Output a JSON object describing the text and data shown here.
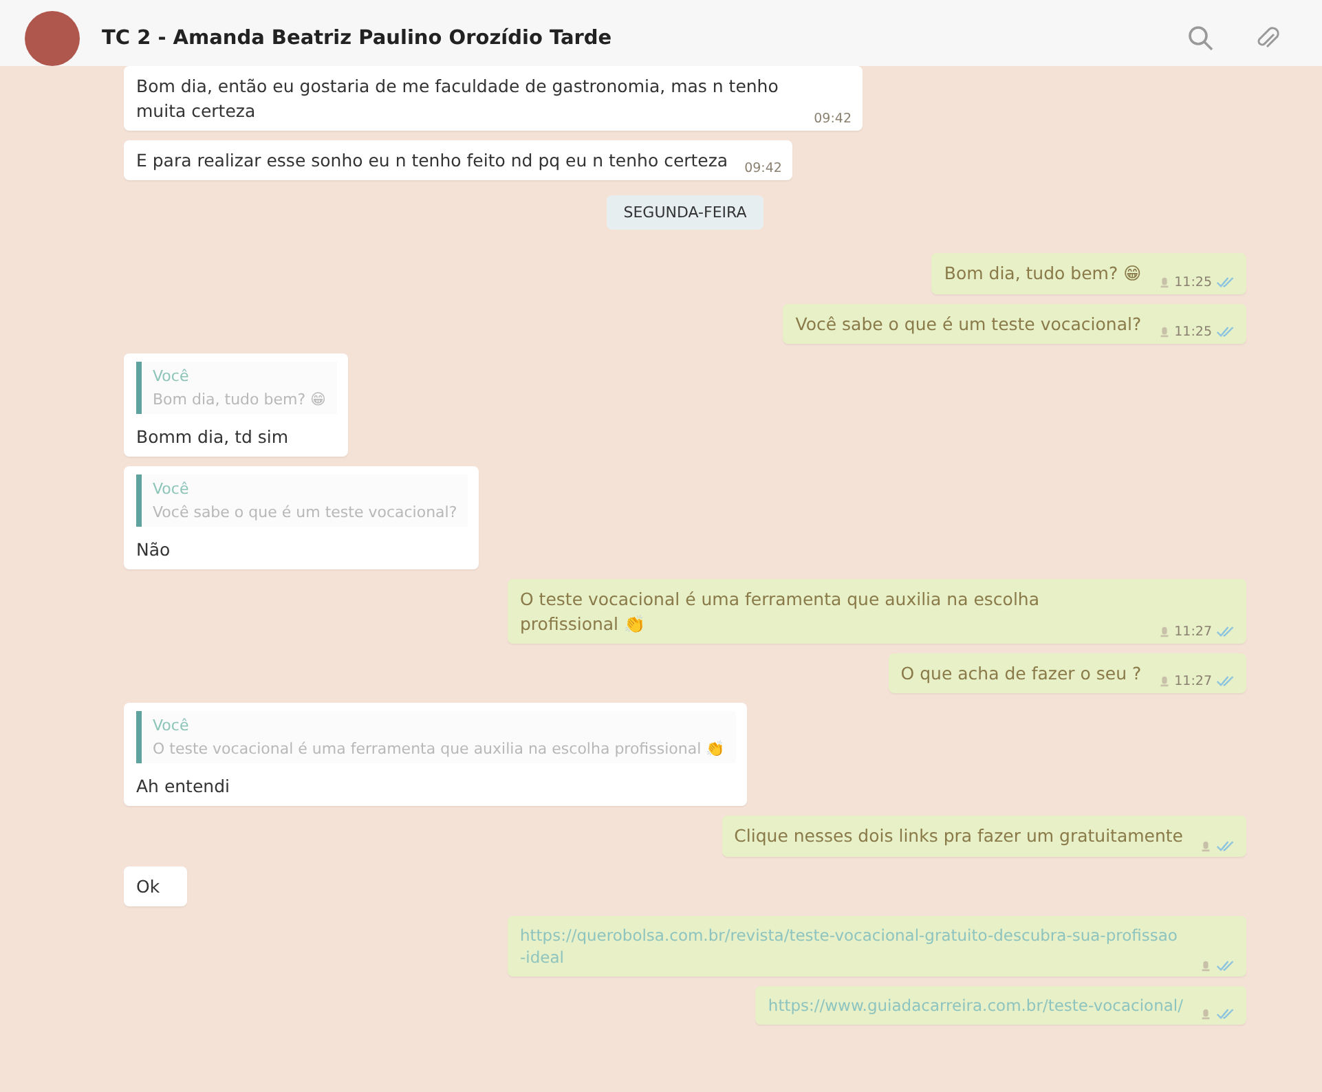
{
  "header": {
    "title": "TC 2 - Amanda Beatriz Paulino Orozídio Tarde"
  },
  "messages": [
    {
      "kind": "in",
      "text": "Bom dia, então eu gostaria de me faculdade de gastronomia, mas n tenho muita certeza",
      "time": "09:42"
    },
    {
      "kind": "in",
      "text": "E para realizar esse sonho eu n tenho feito nd  pq eu n tenho certeza",
      "time": "09:42"
    },
    {
      "kind": "date",
      "text": "SEGUNDA-FEIRA"
    },
    {
      "kind": "out",
      "text": "Bom dia, tudo bem? 😁",
      "time": "11:25"
    },
    {
      "kind": "out",
      "text": "Você sabe o que é um teste vocacional?",
      "time": "11:25"
    },
    {
      "kind": "in",
      "quote_author": "Você",
      "quote_text": "Bom dia, tudo bem? 😁",
      "text": "Bomm dia, td sim"
    },
    {
      "kind": "in",
      "quote_author": "Você",
      "quote_text": "Você sabe o que é um teste vocacional?",
      "text": "Não"
    },
    {
      "kind": "out",
      "text": "O teste vocacional é uma ferramenta que auxilia na escolha profissional 👏",
      "time": "11:27"
    },
    {
      "kind": "out",
      "text": "O que acha de fazer o seu ?",
      "time": "11:27"
    },
    {
      "kind": "in",
      "quote_author": "Você",
      "quote_text": "O teste vocacional é uma ferramenta que auxilia na escolha profissional 👏",
      "text": "Ah entendi"
    },
    {
      "kind": "out",
      "text": "Clique nesses dois links pra fazer um gratuitamente"
    },
    {
      "kind": "in",
      "text": "Ok"
    },
    {
      "kind": "link",
      "text": "https://querobolsa.com.br/revista/teste-vocacional-gratuito-descubra-sua-profissao-ideal"
    },
    {
      "kind": "link",
      "text": "https://www.guiadacarreira.com.br/teste-vocacional/"
    }
  ]
}
